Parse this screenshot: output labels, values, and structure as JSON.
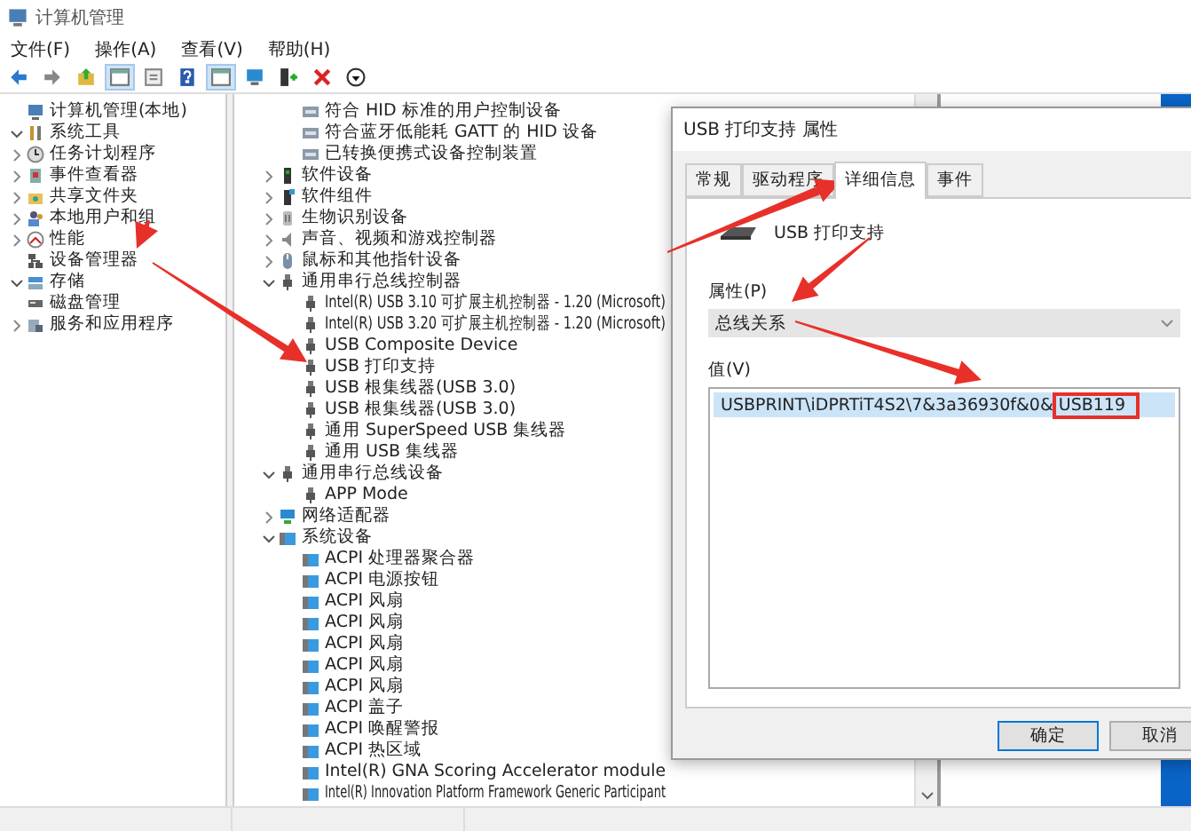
{
  "window": {
    "title": "计算机管理"
  },
  "menu": [
    "文件(F)",
    "操作(A)",
    "查看(V)",
    "帮助(H)"
  ],
  "toolbar": [
    {
      "kind": "back",
      "pressed": false
    },
    {
      "kind": "forward",
      "pressed": false
    },
    {
      "kind": "up",
      "pressed": false
    },
    {
      "kind": "console",
      "pressed": true
    },
    {
      "kind": "list",
      "pressed": false
    },
    {
      "kind": "help",
      "pressed": false
    },
    {
      "kind": "console",
      "pressed": true
    },
    {
      "kind": "monitor",
      "pressed": false
    },
    {
      "kind": "adddriver",
      "pressed": false
    },
    {
      "kind": "remove",
      "pressed": false
    },
    {
      "kind": "download",
      "pressed": false
    }
  ],
  "left_tree": [
    {
      "label": "计算机管理(本地)",
      "kind": "computer",
      "children": [
        {
          "label": "系统工具",
          "kind": "tools",
          "expanded": true,
          "children": [
            {
              "label": "任务计划程序",
              "kind": "clock",
              "expanded": false
            },
            {
              "label": "事件查看器",
              "kind": "event",
              "expanded": false
            },
            {
              "label": "共享文件夹",
              "kind": "share",
              "expanded": false
            },
            {
              "label": "本地用户和组",
              "kind": "users",
              "expanded": false
            },
            {
              "label": "性能",
              "kind": "perf",
              "expanded": false
            },
            {
              "label": "设备管理器",
              "kind": "devmgr"
            }
          ]
        },
        {
          "label": "存储",
          "kind": "storage",
          "expanded": true,
          "children": [
            {
              "label": "磁盘管理",
              "kind": "disk"
            }
          ]
        },
        {
          "label": "服务和应用程序",
          "kind": "services",
          "expanded": false
        }
      ]
    }
  ],
  "right_tree": {
    "continued_children": [
      {
        "label": "符合 HID 标准的用户控制设备",
        "kind": "hid"
      },
      {
        "label": "符合蓝牙低能耗 GATT 的 HID 设备",
        "kind": "hid"
      },
      {
        "label": "已转换便携式设备控制装置",
        "kind": "hid"
      }
    ],
    "groups": [
      {
        "label": "软件设备",
        "kind": "device",
        "expanded": false
      },
      {
        "label": "软件组件",
        "kind": "component",
        "expanded": false
      },
      {
        "label": "生物识别设备",
        "kind": "bio",
        "expanded": false
      },
      {
        "label": "声音、视频和游戏控制器",
        "kind": "audio",
        "expanded": false
      },
      {
        "label": "鼠标和其他指针设备",
        "kind": "mouse",
        "expanded": false
      },
      {
        "label": "通用串行总线控制器",
        "kind": "usb",
        "expanded": true,
        "children": [
          {
            "label": "Intel(R) USB 3.10 可扩展主机控制器 - 1.20 (Microsoft)",
            "kind": "usb"
          },
          {
            "label": "Intel(R) USB 3.20 可扩展主机控制器 - 1.20 (Microsoft)",
            "kind": "usb"
          },
          {
            "label": "USB Composite Device",
            "kind": "usb"
          },
          {
            "label": "USB 打印支持",
            "kind": "usb"
          },
          {
            "label": "USB 根集线器(USB 3.0)",
            "kind": "usb"
          },
          {
            "label": "USB 根集线器(USB 3.0)",
            "kind": "usb"
          },
          {
            "label": "通用 SuperSpeed USB 集线器",
            "kind": "usb"
          },
          {
            "label": "通用 USB 集线器",
            "kind": "usb"
          }
        ]
      },
      {
        "label": "通用串行总线设备",
        "kind": "usb",
        "expanded": true,
        "children": [
          {
            "label": "APP Mode",
            "kind": "usb"
          }
        ]
      },
      {
        "label": "网络适配器",
        "kind": "network",
        "expanded": false
      },
      {
        "label": "系统设备",
        "kind": "system",
        "expanded": true,
        "children": [
          {
            "label": "ACPI 处理器聚合器",
            "kind": "system"
          },
          {
            "label": "ACPI 电源按钮",
            "kind": "system"
          },
          {
            "label": "ACPI 风扇",
            "kind": "system"
          },
          {
            "label": "ACPI 风扇",
            "kind": "system"
          },
          {
            "label": "ACPI 风扇",
            "kind": "system"
          },
          {
            "label": "ACPI 风扇",
            "kind": "system"
          },
          {
            "label": "ACPI 风扇",
            "kind": "system"
          },
          {
            "label": "ACPI 盖子",
            "kind": "system"
          },
          {
            "label": "ACPI 唤醒警报",
            "kind": "system"
          },
          {
            "label": "ACPI 热区域",
            "kind": "system"
          },
          {
            "label": "Intel(R) GNA Scoring Accelerator module",
            "kind": "system"
          },
          {
            "label": "Intel(R) Innovation Platform Framework Generic Participant",
            "kind": "system"
          }
        ]
      }
    ]
  },
  "dialog": {
    "title": "USB 打印支持 属性",
    "tabs": [
      {
        "label": "常规",
        "selected": false
      },
      {
        "label": "驱动程序",
        "selected": false
      },
      {
        "label": "详细信息",
        "selected": true
      },
      {
        "label": "事件",
        "selected": false
      }
    ],
    "device_name": "USB 打印支持",
    "property_label": "属性(P)",
    "property_value": "总线关系",
    "value_label": "值(V)",
    "values": [
      {
        "text": "USBPRINT\\iDPRTiT4S2\\7&3a36930f&0&",
        "highlighted": "USB119",
        "selected": true
      }
    ],
    "buttons": [
      {
        "label": "确定",
        "default": true
      },
      {
        "label": "取消",
        "default": false
      }
    ]
  }
}
